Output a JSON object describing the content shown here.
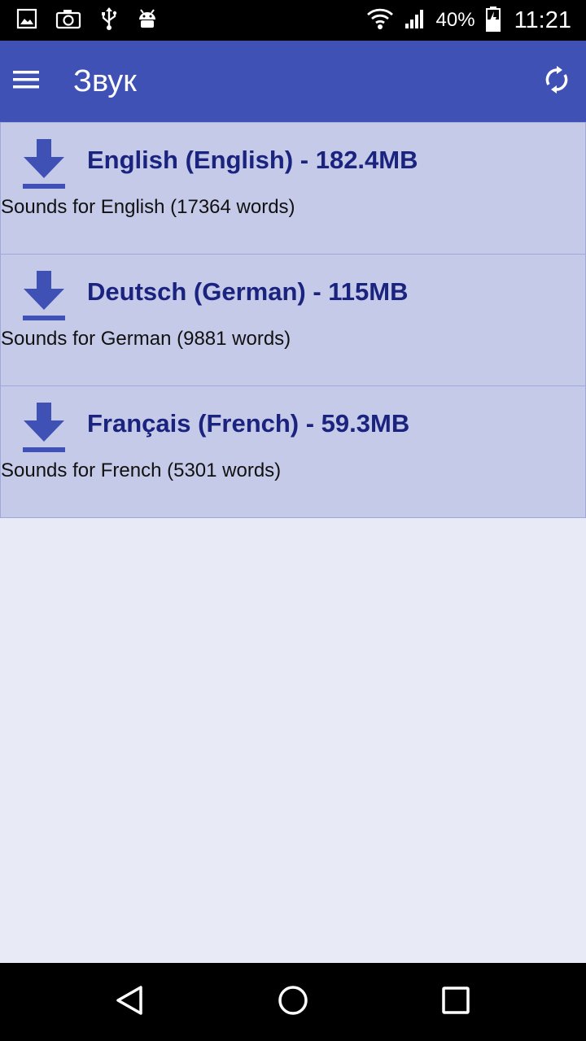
{
  "status_bar": {
    "battery_percent": "40%",
    "time": "11:21",
    "left_icons": [
      "image-icon",
      "camera-icon",
      "usb-icon",
      "android-debug-icon"
    ],
    "right_icons": [
      "wifi-icon",
      "signal-icon",
      "battery-charging-icon"
    ]
  },
  "app_bar": {
    "title": "Звук",
    "color": "#3f51b5"
  },
  "sounds": [
    {
      "title": "English (English) - 182.4MB",
      "description": "Sounds for English (17364 words)",
      "icon": "download-icon"
    },
    {
      "title": "Deutsch (German) - 115MB",
      "description": "Sounds for German (9881 words)",
      "icon": "download-icon"
    },
    {
      "title": "Français (French) - 59.3MB",
      "description": "Sounds for French (5301 words)",
      "icon": "download-icon"
    }
  ],
  "nav_bar": {
    "icons": [
      "back-icon",
      "home-icon",
      "recents-icon"
    ]
  },
  "colors": {
    "card_background": "#c5cae9",
    "title_text": "#1a237e",
    "icon_accent": "#3f51b5",
    "page_background": "#e8eaf6"
  }
}
